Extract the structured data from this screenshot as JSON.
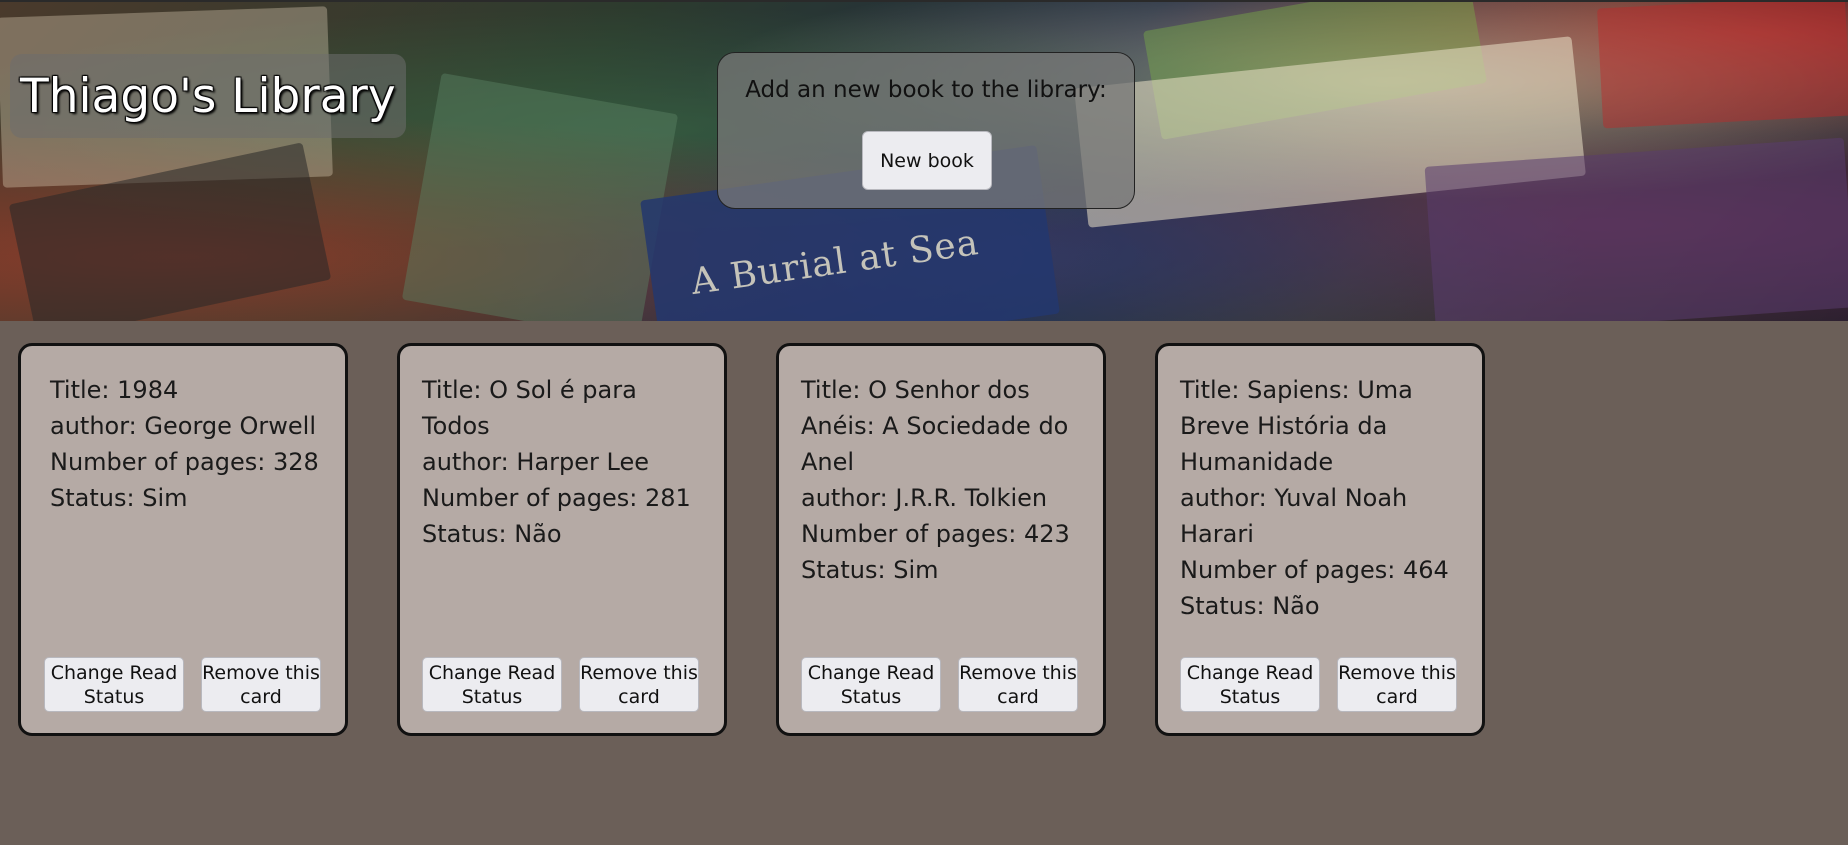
{
  "header": {
    "title": "Thiago's Library",
    "background_text": "A Burial at Sea",
    "add_prompt": "Add an new book to the library:",
    "new_book_label": "New book"
  },
  "labels": {
    "title": "Title: ",
    "author": "author: ",
    "pages": "Number of pages: ",
    "status": "Status: "
  },
  "cards": [
    {
      "title": "1984",
      "author": "George Orwell",
      "pages": "328",
      "status": "Sim",
      "change_label": "Change Read Status",
      "remove_label": "Remove this card"
    },
    {
      "title": "O Sol é para Todos",
      "author": "Harper Lee",
      "pages": "281",
      "status": "Não",
      "change_label": "Change Read Status",
      "remove_label": "Remove this card"
    },
    {
      "title": "O Senhor dos Anéis: A Sociedade do Anel",
      "author": "J.R.R. Tolkien",
      "pages": "423",
      "status": "Sim",
      "change_label": "Change Read Status",
      "remove_label": "Remove this card"
    },
    {
      "title": "Sapiens: Uma Breve História da Humanidade",
      "author": "Yuval Noah Harari",
      "pages": "464",
      "status": "Não",
      "change_label": "Change Read Status",
      "remove_label": "Remove this card"
    }
  ],
  "colors": {
    "page_background": "#6b5f58",
    "card_background": "#b5aaa5",
    "button_background": "#ececf0"
  }
}
